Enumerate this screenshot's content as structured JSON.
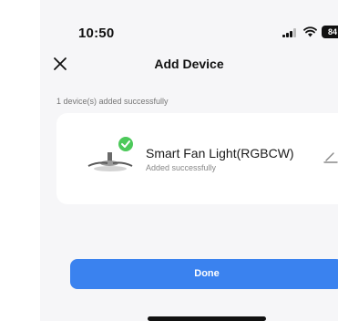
{
  "status_bar": {
    "time": "10:50",
    "battery": "84"
  },
  "nav": {
    "title": "Add Device",
    "close_icon": "close-icon"
  },
  "summary": {
    "caption": "1 device(s) added successfully"
  },
  "device": {
    "name": "Smart Fan Light(RGBCW)",
    "status": "Added successfully",
    "icons": [
      "device-image",
      "check-badge-icon",
      "edit-icon"
    ]
  },
  "actions": {
    "done_label": "Done"
  },
  "colors": {
    "accent": "#3a82ef",
    "success": "#4cc95a",
    "background": "#f6f6f8"
  }
}
